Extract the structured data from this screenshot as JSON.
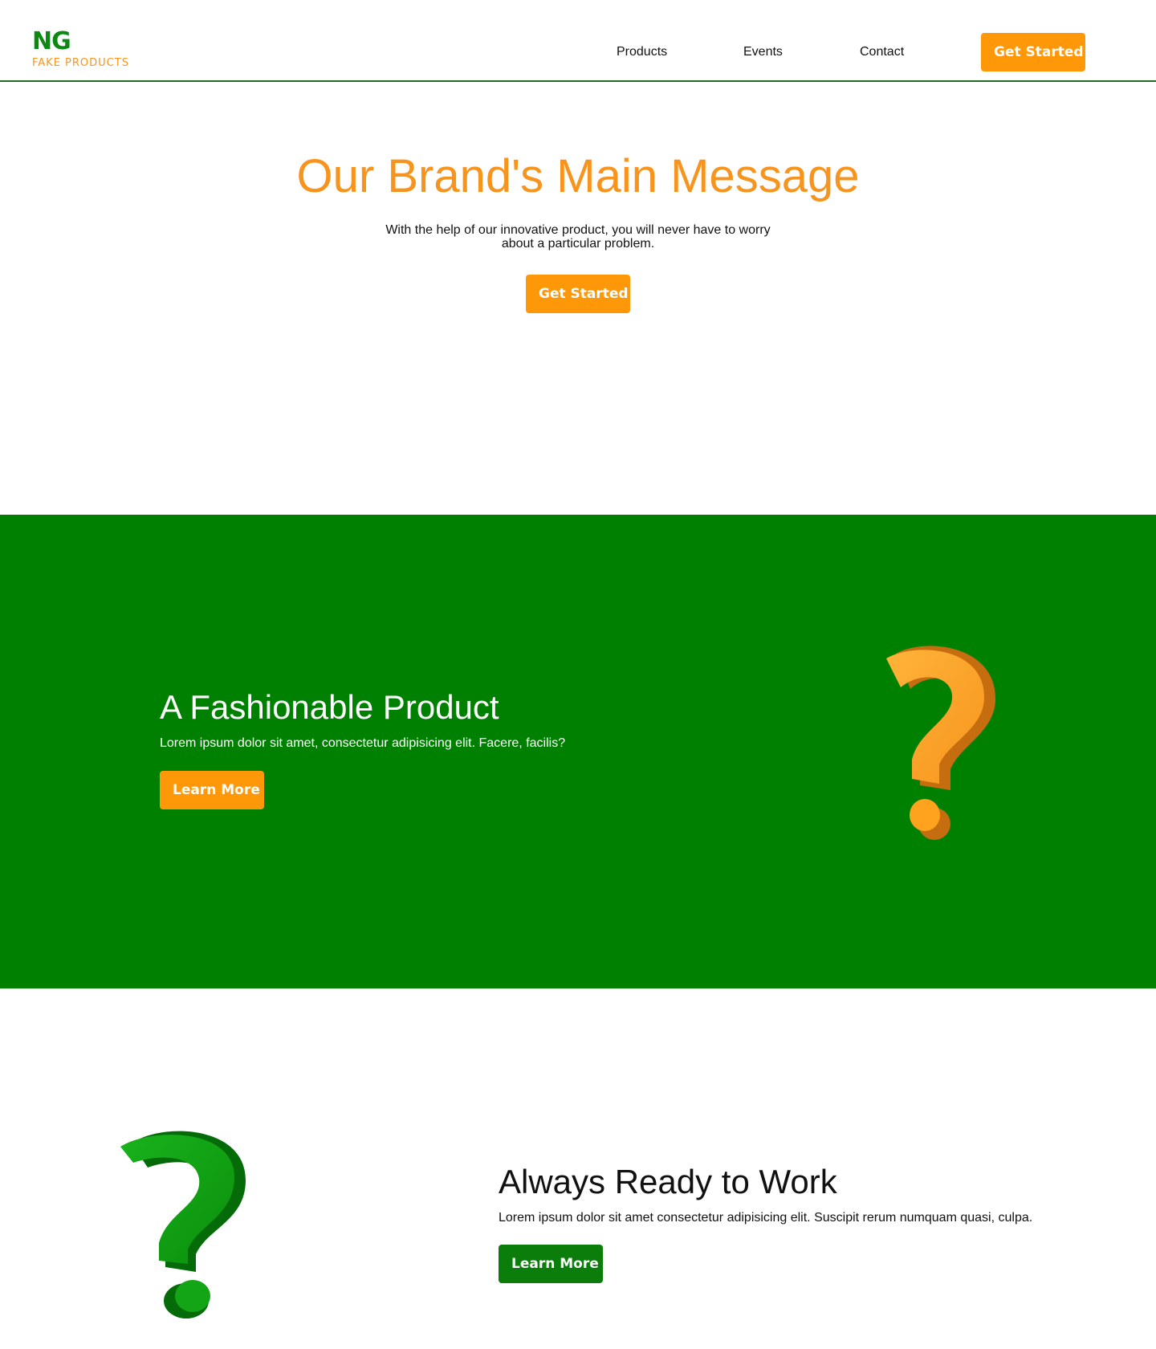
{
  "brand": {
    "mark": "NG",
    "name": "FAKE PRODUCTS"
  },
  "nav": {
    "items": [
      "Products",
      "Events",
      "Contact"
    ],
    "cta_label": "Get Started"
  },
  "hero": {
    "title": "Our Brand's Main Message",
    "subtitle": "With the help of our innovative product, you will never have to worry about a particular problem.",
    "cta_label": "Get Started"
  },
  "feature_1": {
    "title": "A Fashionable Product",
    "text": "Lorem ipsum dolor sit amet, consectetur adipisicing elit. Facere, facilis?",
    "cta_label": "Learn More",
    "image_icon": "question-mark-orange-icon"
  },
  "feature_2": {
    "title": "Always Ready to Work",
    "text": "Lorem ipsum dolor sit amet consectetur adipisicing elit. Suscipit rerum numquam quasi, culpa.",
    "cta_label": "Learn More",
    "image_icon": "question-mark-green-icon"
  },
  "colors": {
    "brand_green": "#008000",
    "brand_orange": "#ff9808",
    "heading_orange": "#f7941d"
  }
}
